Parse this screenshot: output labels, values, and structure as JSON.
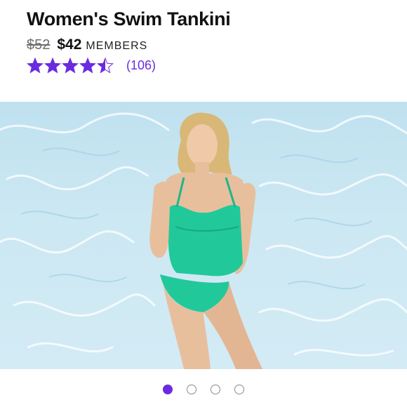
{
  "product": {
    "title": "Women's Swim Tankini",
    "original_price": "$52",
    "member_price": "$42",
    "member_label": "MEMBERS"
  },
  "rating": {
    "value": 4.5,
    "max": 5,
    "count_label": "(106)",
    "star_color": "#6a2be0"
  },
  "gallery": {
    "image_alt": "Woman wearing a green swim tankini in front of pool water",
    "total_images": 4,
    "active_index": 0,
    "accent_color": "#6a2be0"
  }
}
